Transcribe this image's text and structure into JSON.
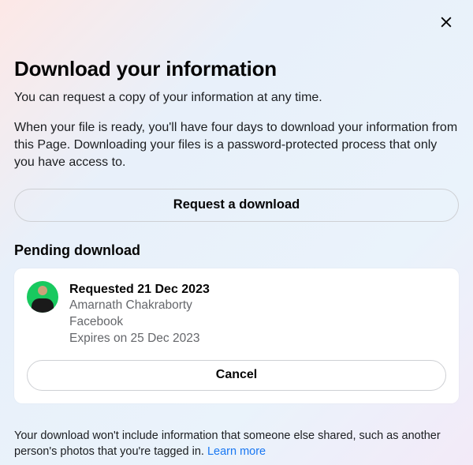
{
  "title": "Download your information",
  "subtitle": "You can request a copy of your information at any time.",
  "description": "When your file is ready, you'll have four days to download your information from this Page. Downloading your files is a password-protected process that only you have access to.",
  "request_button": "Request a download",
  "pending_section_title": "Pending download",
  "pending": {
    "requested_label": "Requested 21 Dec 2023",
    "user_name": "Amarnath Chakraborty",
    "platform": "Facebook",
    "expires_label": "Expires on 25 Dec 2023",
    "cancel_label": "Cancel"
  },
  "footer_text": "Your download won't include information that someone else shared, such as another person's photos that you're tagged in. ",
  "learn_more_label": "Learn more"
}
